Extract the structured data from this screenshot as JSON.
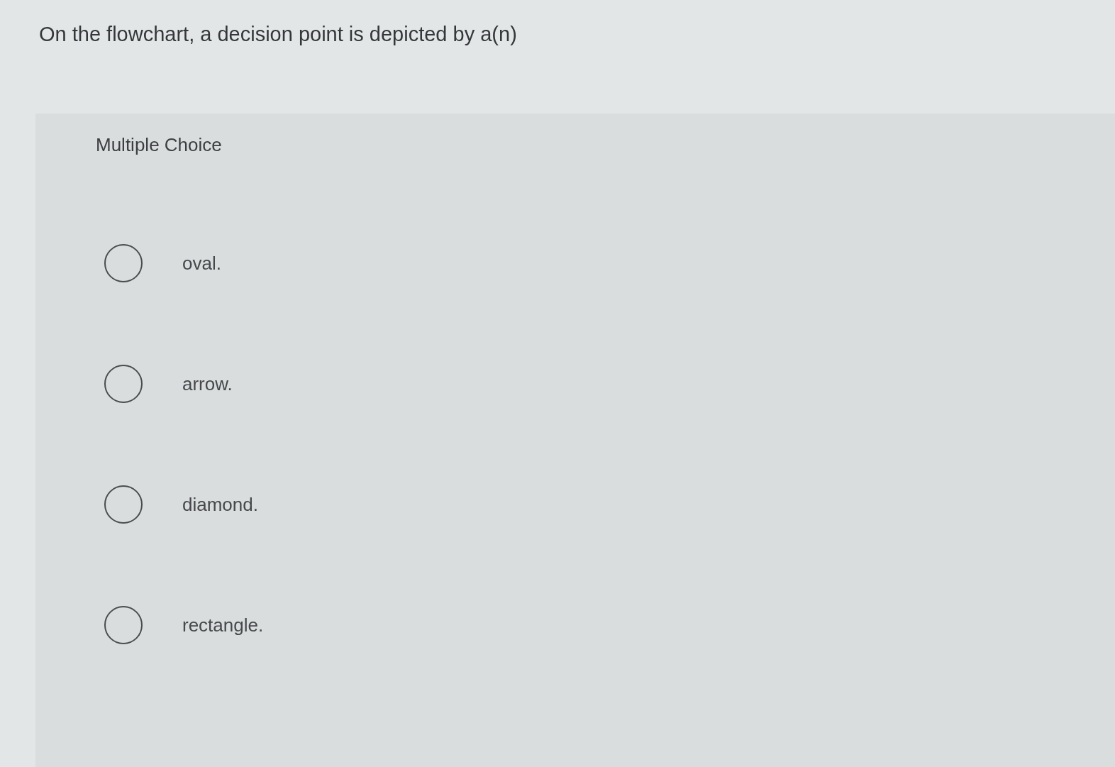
{
  "question": {
    "text": "On the flowchart, a decision point is depicted by a(n)"
  },
  "panel": {
    "heading": "Multiple Choice"
  },
  "options": [
    {
      "label": "oval.",
      "selected": false
    },
    {
      "label": "arrow.",
      "selected": false
    },
    {
      "label": "diamond.",
      "selected": false
    },
    {
      "label": "rectangle.",
      "selected": false
    }
  ]
}
